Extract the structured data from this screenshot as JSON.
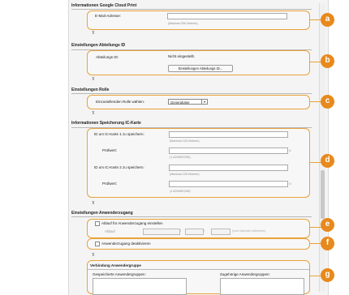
{
  "google": {
    "title": "Informationen Google Cloud Print",
    "email_label": "E-Mail-Adresse:",
    "email_hint": "(Maximal 256 Zeichen)",
    "badge": "a"
  },
  "dept": {
    "title": "Einstellungen Abteilungs ID",
    "id_label": "Abteilungs ID:",
    "id_value": "Nicht eingestellt.",
    "button": "Einstellungen Abteilungs ID...",
    "badge": "b"
  },
  "role": {
    "title": "Einstellungen Rolle",
    "label": "Einzustellenden Rolle wählen:",
    "selected": "GeneralUser",
    "badge": "c"
  },
  "ic": {
    "title": "Informationen Speicherung IC-Karte",
    "id1_label": "ID um IC-Karte 1 zu speichern:",
    "id1_hint": "(Maximal 128 Zeichen)",
    "check1_label": "Prüfwert:",
    "check1_hint": "(1-4294967295)",
    "id2_label": "ID um IC-Karte 2 zu speichern:",
    "id2_hint": "(Maximal 128 Zeichen)",
    "check2_label": "Prüfwert:",
    "check2_hint": "(1-4294967295)",
    "badge": "d"
  },
  "access": {
    "title": "Einstellungen Anwenderzugang",
    "expiry_label": "Ablauf für Anwenderzugang einstellen",
    "expiry_sub": "Ablauf",
    "date_hint": "(vom Kalender definieren)",
    "badge_e": "e",
    "disable_label": "Anwenderzugang deaktivieren",
    "badge_f": "f"
  },
  "group": {
    "title": "Verbindung Anwendergruppe",
    "registered_label": "Gespeicherte Anwendergruppen:",
    "member_label": "Zugehörige Anwendergruppen:",
    "badge": "g"
  },
  "colors": {
    "badge": "#e8891d",
    "highlight_border": "#e8a23a"
  }
}
